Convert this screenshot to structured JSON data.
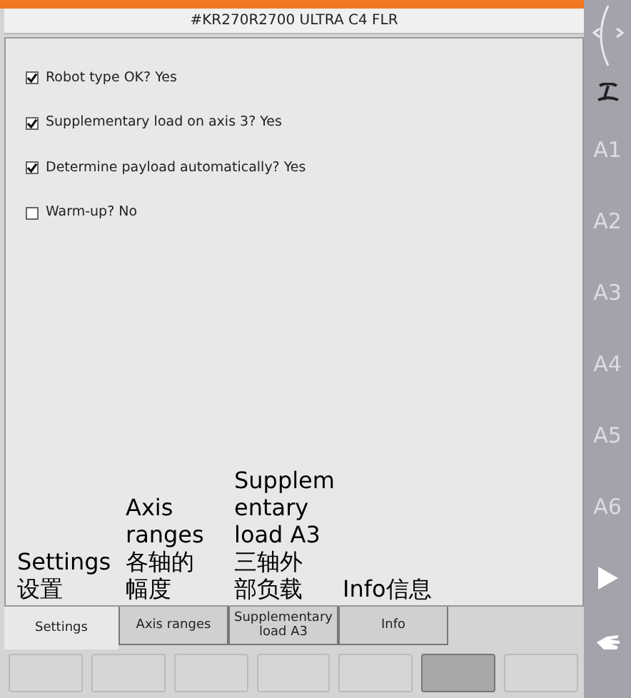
{
  "header": {
    "robot": "#KR270R2700 ULTRA C4 FLR"
  },
  "settings": [
    {
      "label": "Robot type OK? Yes",
      "checked": true
    },
    {
      "label": "Supplementary load on axis 3? Yes",
      "checked": true
    },
    {
      "label": "Determine payload automatically? Yes",
      "checked": true
    },
    {
      "label": "Warm-up? No",
      "checked": false
    }
  ],
  "annotations": [
    {
      "lines": [
        "Settings",
        "设置"
      ]
    },
    {
      "lines": [
        "Axis",
        "ranges",
        "各轴的",
        "幅度"
      ]
    },
    {
      "lines": [
        "Supplem",
        "entary",
        "load A3",
        "三轴外",
        "部负载"
      ]
    },
    {
      "lines": [
        "Info信息"
      ]
    }
  ],
  "tabs": [
    {
      "label": "Settings",
      "selected": true
    },
    {
      "label": "Axis ranges",
      "selected": false
    },
    {
      "label": "Supplementary load A3",
      "selected": false
    },
    {
      "label": "Info",
      "selected": false
    }
  ],
  "softkeys": [
    {
      "pressed": false
    },
    {
      "pressed": false
    },
    {
      "pressed": false
    },
    {
      "pressed": false
    },
    {
      "pressed": false
    },
    {
      "pressed": true
    },
    {
      "pressed": false
    }
  ],
  "side_keys": [
    {
      "kind": "arc"
    },
    {
      "kind": "script"
    },
    {
      "kind": "axis",
      "label": "A1"
    },
    {
      "kind": "axis",
      "label": "A2"
    },
    {
      "kind": "axis",
      "label": "A3"
    },
    {
      "kind": "axis",
      "label": "A4"
    },
    {
      "kind": "axis",
      "label": "A5"
    },
    {
      "kind": "axis",
      "label": "A6"
    },
    {
      "kind": "play"
    },
    {
      "kind": "hand"
    }
  ]
}
